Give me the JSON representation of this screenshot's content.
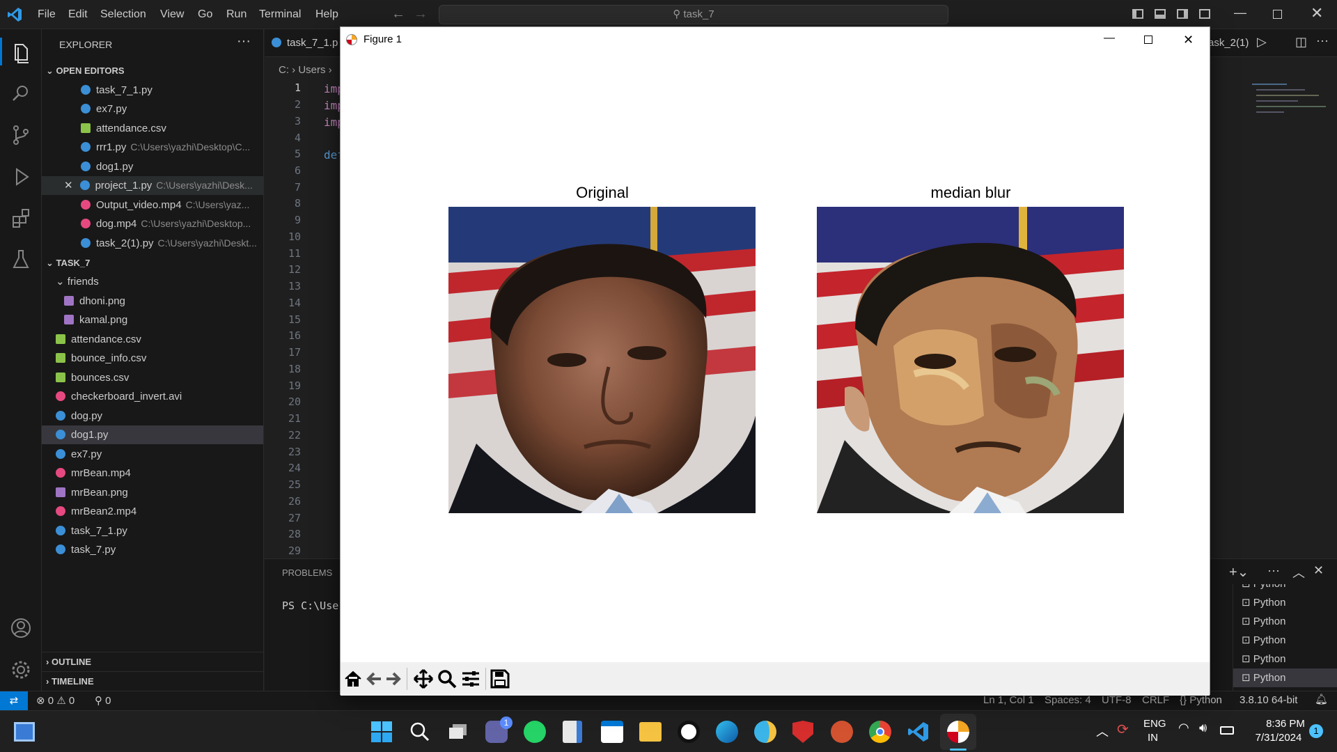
{
  "titlebar": {
    "menus": [
      "File",
      "Edit",
      "Selection",
      "View",
      "Go",
      "Run",
      "Terminal",
      "Help"
    ],
    "search": "task_7"
  },
  "explorer": {
    "title": "EXPLORER",
    "open_editors_label": "OPEN EDITORS",
    "open_editors": [
      {
        "name": "task_7_1.py",
        "path": "",
        "type": "py"
      },
      {
        "name": "ex7.py",
        "path": "",
        "type": "py"
      },
      {
        "name": "attendance.csv",
        "path": "",
        "type": "csv"
      },
      {
        "name": "rrr1.py",
        "path": "C:\\Users\\yazhi\\Desktop\\C...",
        "type": "py"
      },
      {
        "name": "dog1.py",
        "path": "",
        "type": "py"
      },
      {
        "name": "project_1.py",
        "path": "C:\\Users\\yazhi\\Desk...",
        "type": "py"
      },
      {
        "name": "Output_video.mp4",
        "path": "C:\\Users\\yaz...",
        "type": "vid"
      },
      {
        "name": "dog.mp4",
        "path": "C:\\Users\\yazhi\\Desktop...",
        "type": "vid"
      },
      {
        "name": "task_2(1).py",
        "path": "C:\\Users\\yazhi\\Deskt...",
        "type": "py"
      }
    ],
    "folder_label": "TASK_7",
    "subfolder": "friends",
    "subfolder_files": [
      {
        "name": "dhoni.png",
        "type": "png"
      },
      {
        "name": "kamal.png",
        "type": "png"
      }
    ],
    "files": [
      {
        "name": "attendance.csv",
        "type": "csv"
      },
      {
        "name": "bounce_info.csv",
        "type": "csv"
      },
      {
        "name": "bounces.csv",
        "type": "csv"
      },
      {
        "name": "checkerboard_invert.avi",
        "type": "vid"
      },
      {
        "name": "dog.py",
        "type": "py"
      },
      {
        "name": "dog1.py",
        "type": "py"
      },
      {
        "name": "ex7.py",
        "type": "py"
      },
      {
        "name": "mrBean.mp4",
        "type": "vid"
      },
      {
        "name": "mrBean.png",
        "type": "png"
      },
      {
        "name": "mrBean2.mp4",
        "type": "vid"
      },
      {
        "name": "task_7_1.py",
        "type": "py"
      },
      {
        "name": "task_7.py",
        "type": "py"
      }
    ],
    "outline_label": "OUTLINE",
    "timeline_label": "TIMELINE"
  },
  "editor": {
    "tab_label": "task_7_1.p",
    "right_tab_label": "ask_2(1)",
    "breadcrumb_drive": "C:",
    "breadcrumb_users": "Users",
    "line_numbers": [
      "1",
      "2",
      "3",
      "4",
      "5",
      "6",
      "7",
      "8",
      "9",
      "10",
      "11",
      "12",
      "13",
      "14",
      "15",
      "16",
      "17",
      "18",
      "19",
      "20",
      "21",
      "22",
      "23",
      "24",
      "25",
      "26",
      "27",
      "28",
      "29"
    ],
    "code_line_1": "imp",
    "code_line_2": "imp",
    "code_line_3": "imp",
    "code_line_5": "def"
  },
  "panel": {
    "tab_problems": "PROBLEMS",
    "terminal_text": "PS C:\\Use",
    "terminals": [
      "Python",
      "Python",
      "Python",
      "Python",
      "Python",
      "Python"
    ]
  },
  "statusbar": {
    "errors": "0",
    "warnings": "0",
    "ports": "0",
    "position": "Ln 1, Col 1",
    "spaces": "Spaces: 4",
    "encoding": "UTF-8",
    "eol": "CRLF",
    "language": "Python",
    "interpreter": "3.8.10 64-bit"
  },
  "figure": {
    "window_title": "Figure 1",
    "plots": [
      {
        "title": "Original"
      },
      {
        "title": "median blur"
      }
    ]
  },
  "taskbar": {
    "lang": "ENG",
    "region": "IN",
    "time": "8:36 PM",
    "date": "7/31/2024",
    "notification_count": "1",
    "teams_badge": "1"
  }
}
